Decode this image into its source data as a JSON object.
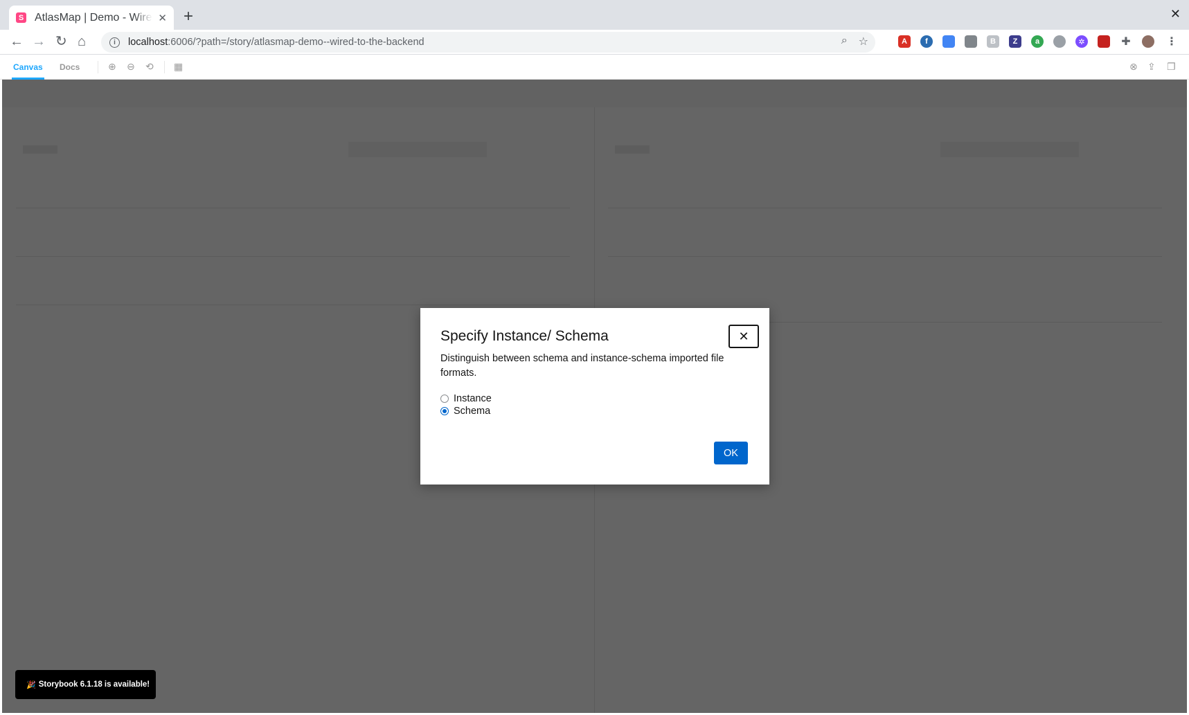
{
  "browser": {
    "tab_title": "AtlasMap | Demo - Wired to the backend",
    "favicon_letter": "S",
    "url_host": "localhost",
    "url_rest": ":6006/?path=/story/atlasmap-demo--wired-to-the-backend"
  },
  "storybook": {
    "tabs": [
      {
        "label": "Canvas"
      },
      {
        "label": "Docs"
      }
    ]
  },
  "modal": {
    "title": "Specify Instance/ Schema",
    "description": "Distinguish between schema and instance-schema imported file formats.",
    "options": [
      {
        "label": "Instance",
        "checked": false
      },
      {
        "label": "Schema",
        "checked": true
      }
    ],
    "ok_label": "OK",
    "close_glyph": "✕"
  },
  "toast": {
    "icon": "🎉",
    "text": "Storybook 6.1.18 is available!"
  },
  "colors": {
    "primary": "#0066cc",
    "storybook_accent": "#1ea7fd",
    "overlay": "rgba(21,21,21,0.66)"
  }
}
